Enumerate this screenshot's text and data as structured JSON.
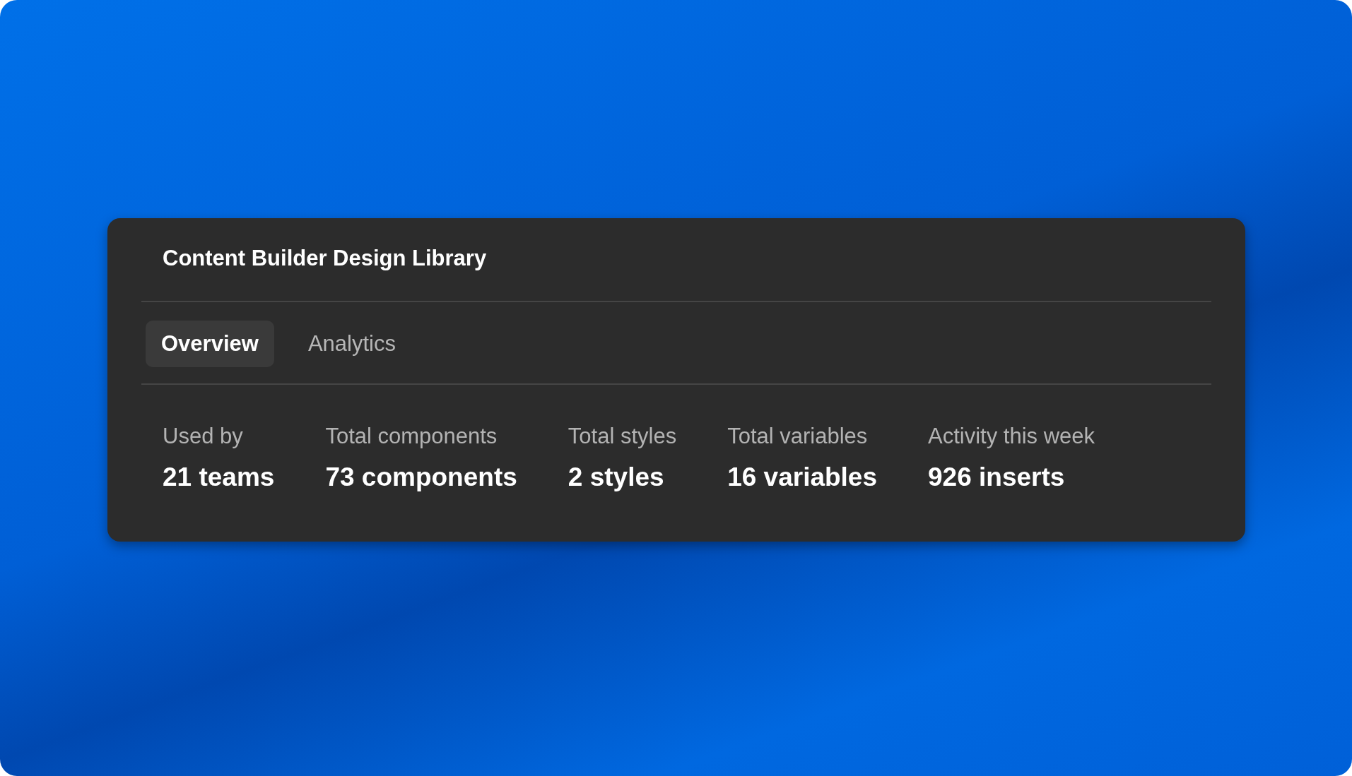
{
  "card": {
    "title": "Content Builder Design Library",
    "tabs": [
      {
        "label": "Overview",
        "selected": true
      },
      {
        "label": "Analytics",
        "selected": false
      }
    ],
    "stats": [
      {
        "label": "Used by",
        "value": "21 teams"
      },
      {
        "label": "Total components",
        "value": "73 components"
      },
      {
        "label": "Total styles",
        "value": "2 styles"
      },
      {
        "label": "Total variables",
        "value": "16 variables"
      },
      {
        "label": "Activity this week",
        "value": "926 inserts"
      }
    ]
  }
}
